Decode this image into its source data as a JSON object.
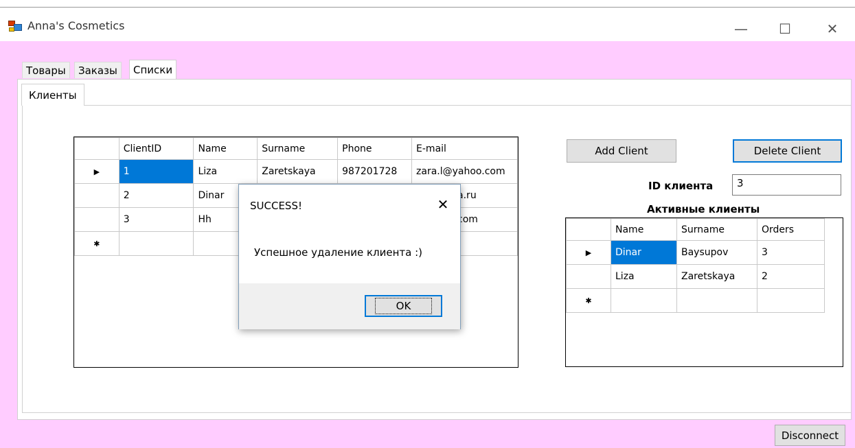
{
  "window": {
    "title": "Anna's Cosmetics",
    "minimize": "—",
    "maximize": "☐",
    "close": "✕"
  },
  "tabs": [
    {
      "label": "Товары"
    },
    {
      "label": "Заказы"
    },
    {
      "label": "Списки"
    }
  ],
  "inner_tab": {
    "label": "Клиенты"
  },
  "clients_grid": {
    "columns": [
      "ClientID",
      "Name",
      "Surname",
      "Phone",
      "E-mail"
    ],
    "rows": [
      [
        "1",
        "Liza",
        "Zaretskaya",
        "987201728",
        "zara.l@yahoo.com"
      ],
      [
        "2",
        "Dinar",
        "",
        "",
        "a.ru"
      ],
      [
        "3",
        "Hh",
        "",
        "",
        "com"
      ]
    ],
    "current_row_marker": "▶",
    "new_row_marker": "✱"
  },
  "buttons": {
    "add_client": "Add Client",
    "delete_client": "Delete Client",
    "disconnect": "Disconnect"
  },
  "client_id": {
    "label": "ID клиента",
    "value": "3"
  },
  "active_clients": {
    "title": "Активные клиенты",
    "columns": [
      "Name",
      "Surname",
      "Orders"
    ],
    "rows": [
      [
        "Dinar",
        "Baysupov",
        "3"
      ],
      [
        "Liza",
        "Zaretskaya",
        "2"
      ]
    ]
  },
  "message_box": {
    "title": "SUCCESS!",
    "text": "Успешное удаление клиента :)",
    "ok": "OK",
    "close": "✕"
  },
  "colors": {
    "form_background": "#ffccff",
    "selection": "#0078d7"
  }
}
